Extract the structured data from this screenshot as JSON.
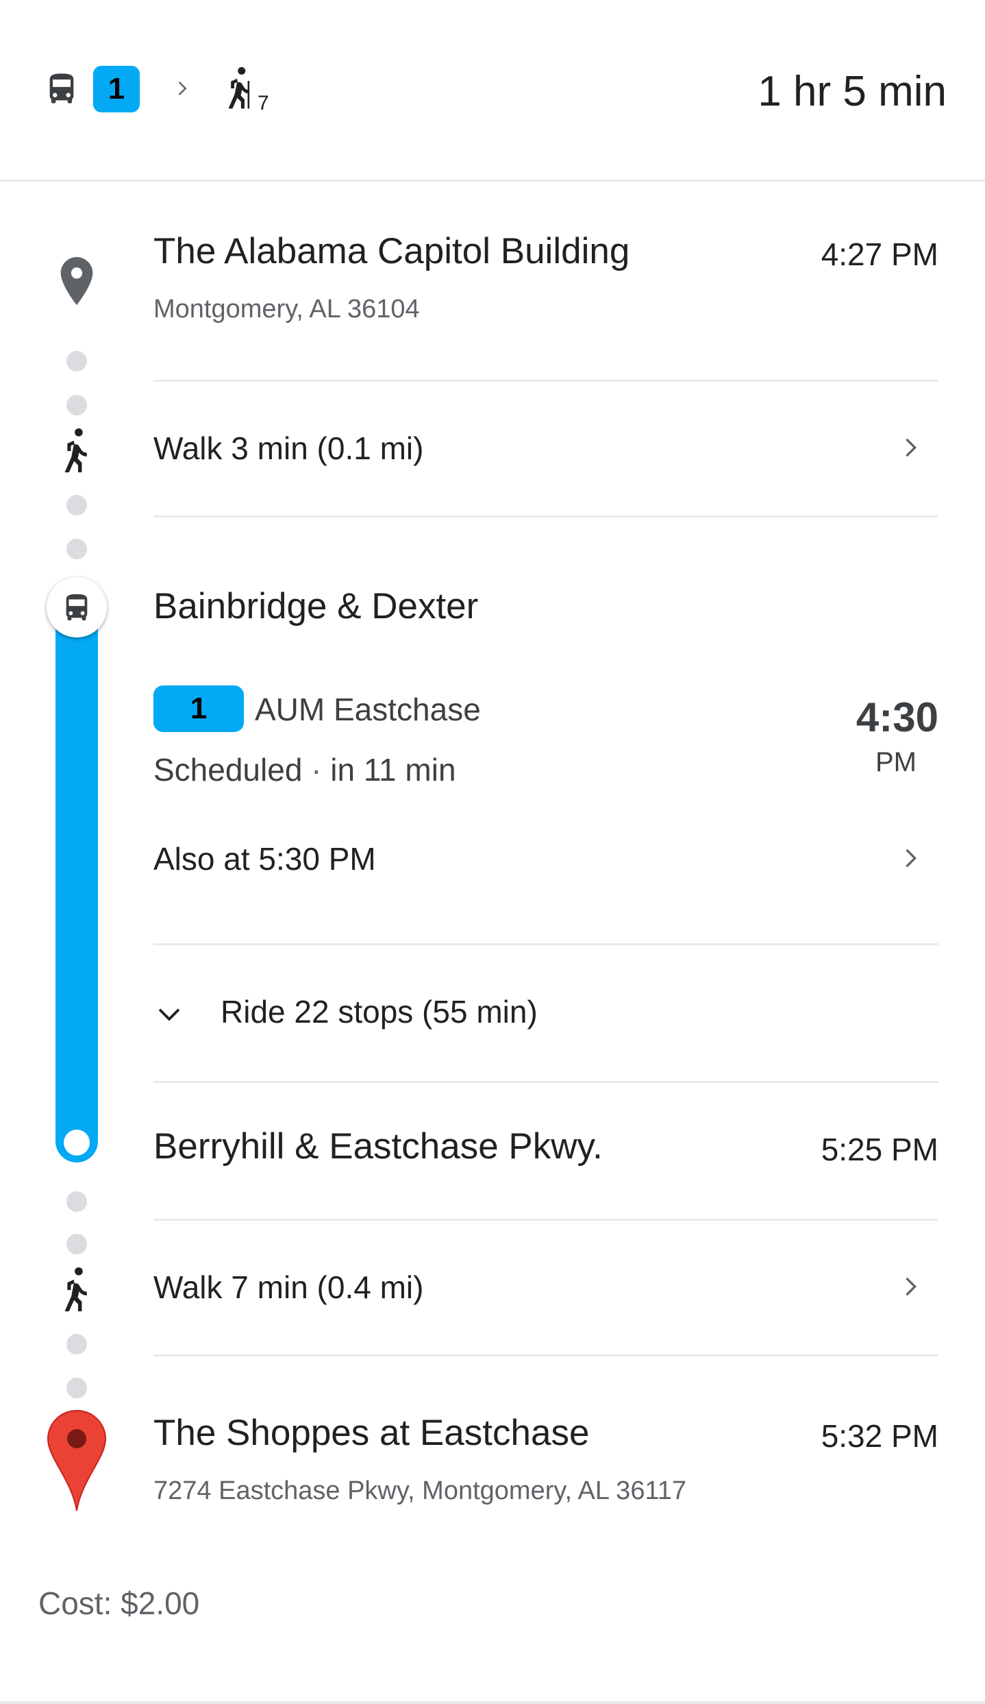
{
  "summary": {
    "route_badge": "1",
    "walk_minutes": "7",
    "total_duration": "1 hr 5 min"
  },
  "origin": {
    "name": "The Alabama Capitol Building",
    "address": "Montgomery, AL 36104",
    "time": "4:27 PM"
  },
  "walk1": {
    "label": "Walk 3 min (0.1 mi)"
  },
  "board": {
    "stop_name": "Bainbridge & Dexter",
    "route_badge": "1",
    "headsign": "AUM Eastchase",
    "status": "Scheduled",
    "eta": "in 11 min",
    "departure_time": "4:30",
    "departure_ampm": "PM",
    "also_at": "Also at 5:30 PM",
    "ride": "Ride 22 stops (55 min)"
  },
  "alight": {
    "stop_name": "Berryhill & Eastchase Pkwy.",
    "time": "5:25 PM"
  },
  "walk2": {
    "label": "Walk 7 min (0.4 mi)"
  },
  "destination": {
    "name": "The Shoppes at Eastchase",
    "address": "7274 Eastchase Pkwy, Montgomery, AL 36117",
    "time": "5:32 PM"
  },
  "cost": {
    "label": "Cost:",
    "value": "$2.00"
  },
  "colors": {
    "transit_line": "#03a9f4",
    "dot": "#dadce0",
    "divider": "#e8eaed",
    "destination_pin": "#ea4335",
    "secondary_text": "#5f6368"
  }
}
